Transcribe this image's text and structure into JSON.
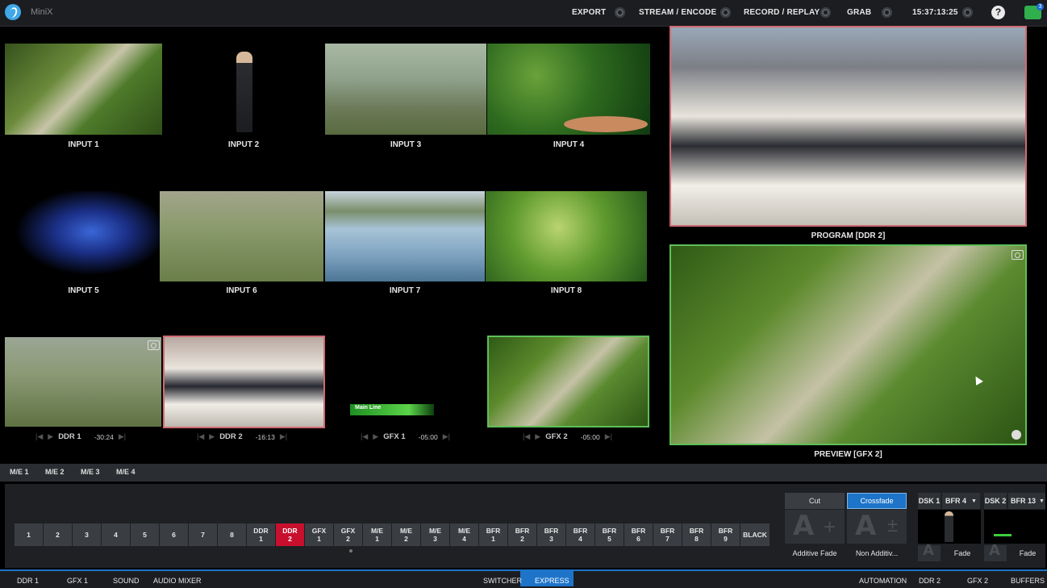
{
  "app": {
    "name": "MiniX"
  },
  "topbar": {
    "export": "EXPORT",
    "stream": "STREAM / ENCODE",
    "record": "RECORD / REPLAY",
    "grab": "GRAB",
    "clock": "15:37:13:25",
    "help": "?",
    "notifications": "3"
  },
  "monitors": {
    "input1": "INPUT 1",
    "input2": "INPUT 2",
    "input3": "INPUT 3",
    "input4": "INPUT 4",
    "input5": "INPUT 5",
    "input6": "INPUT 6",
    "input7": "INPUT 7",
    "input8": "INPUT 8",
    "ddr1": {
      "label": "DDR 1",
      "time": "-30:24"
    },
    "ddr2": {
      "label": "DDR 2",
      "time": "-16:13"
    },
    "gfx1": {
      "label": "GFX 1",
      "time": "-05:00",
      "lower_third": "Main Line"
    },
    "gfx2": {
      "label": "GFX 2",
      "time": "-05:00"
    },
    "program": "PROGRAM [DDR 2]",
    "preview": "PREVIEW [GFX 2]"
  },
  "me_tabs": [
    "M/E 1",
    "M/E 2",
    "M/E 3",
    "M/E 4"
  ],
  "switcher_buttons": [
    "1",
    "2",
    "3",
    "4",
    "5",
    "6",
    "7",
    "8",
    "DDR\n1",
    "DDR\n2",
    "GFX\n1",
    "GFX\n2",
    "M/E\n1",
    "M/E\n2",
    "M/E\n3",
    "M/E\n4",
    "BFR\n1",
    "BFR\n2",
    "BFR\n3",
    "BFR\n4",
    "BFR\n5",
    "BFR\n6",
    "BFR\n7",
    "BFR\n8",
    "BFR\n9",
    "BLACK"
  ],
  "active_button": "DDR\n2",
  "transition": {
    "cut": "Cut",
    "crossfade": "Crossfade",
    "additive": "Additive Fade",
    "nonadditive": "Non Additiv..."
  },
  "dsk": {
    "dsk1": "DSK 1",
    "dsk1_source": "BFR 4",
    "dsk2": "DSK 2",
    "dsk2_source": "BFR 13",
    "fade1": "Fade",
    "fade2": "Fade"
  },
  "bottom_tabs": {
    "ddr1": "DDR 1",
    "gfx1": "GFX 1",
    "sound": "SOUND",
    "audio_mixer": "AUDIO MIXER",
    "switcher": "SWITCHER",
    "express": "EXPRESS",
    "automation": "AUTOMATION",
    "ddr2": "DDR 2",
    "gfx2": "GFX 2",
    "buffers": "BUFFERS"
  },
  "colors": {
    "accent": "#1e74c9",
    "program": "#c8102e",
    "preview": "#5fbf58",
    "notify": "#2fb04c"
  }
}
